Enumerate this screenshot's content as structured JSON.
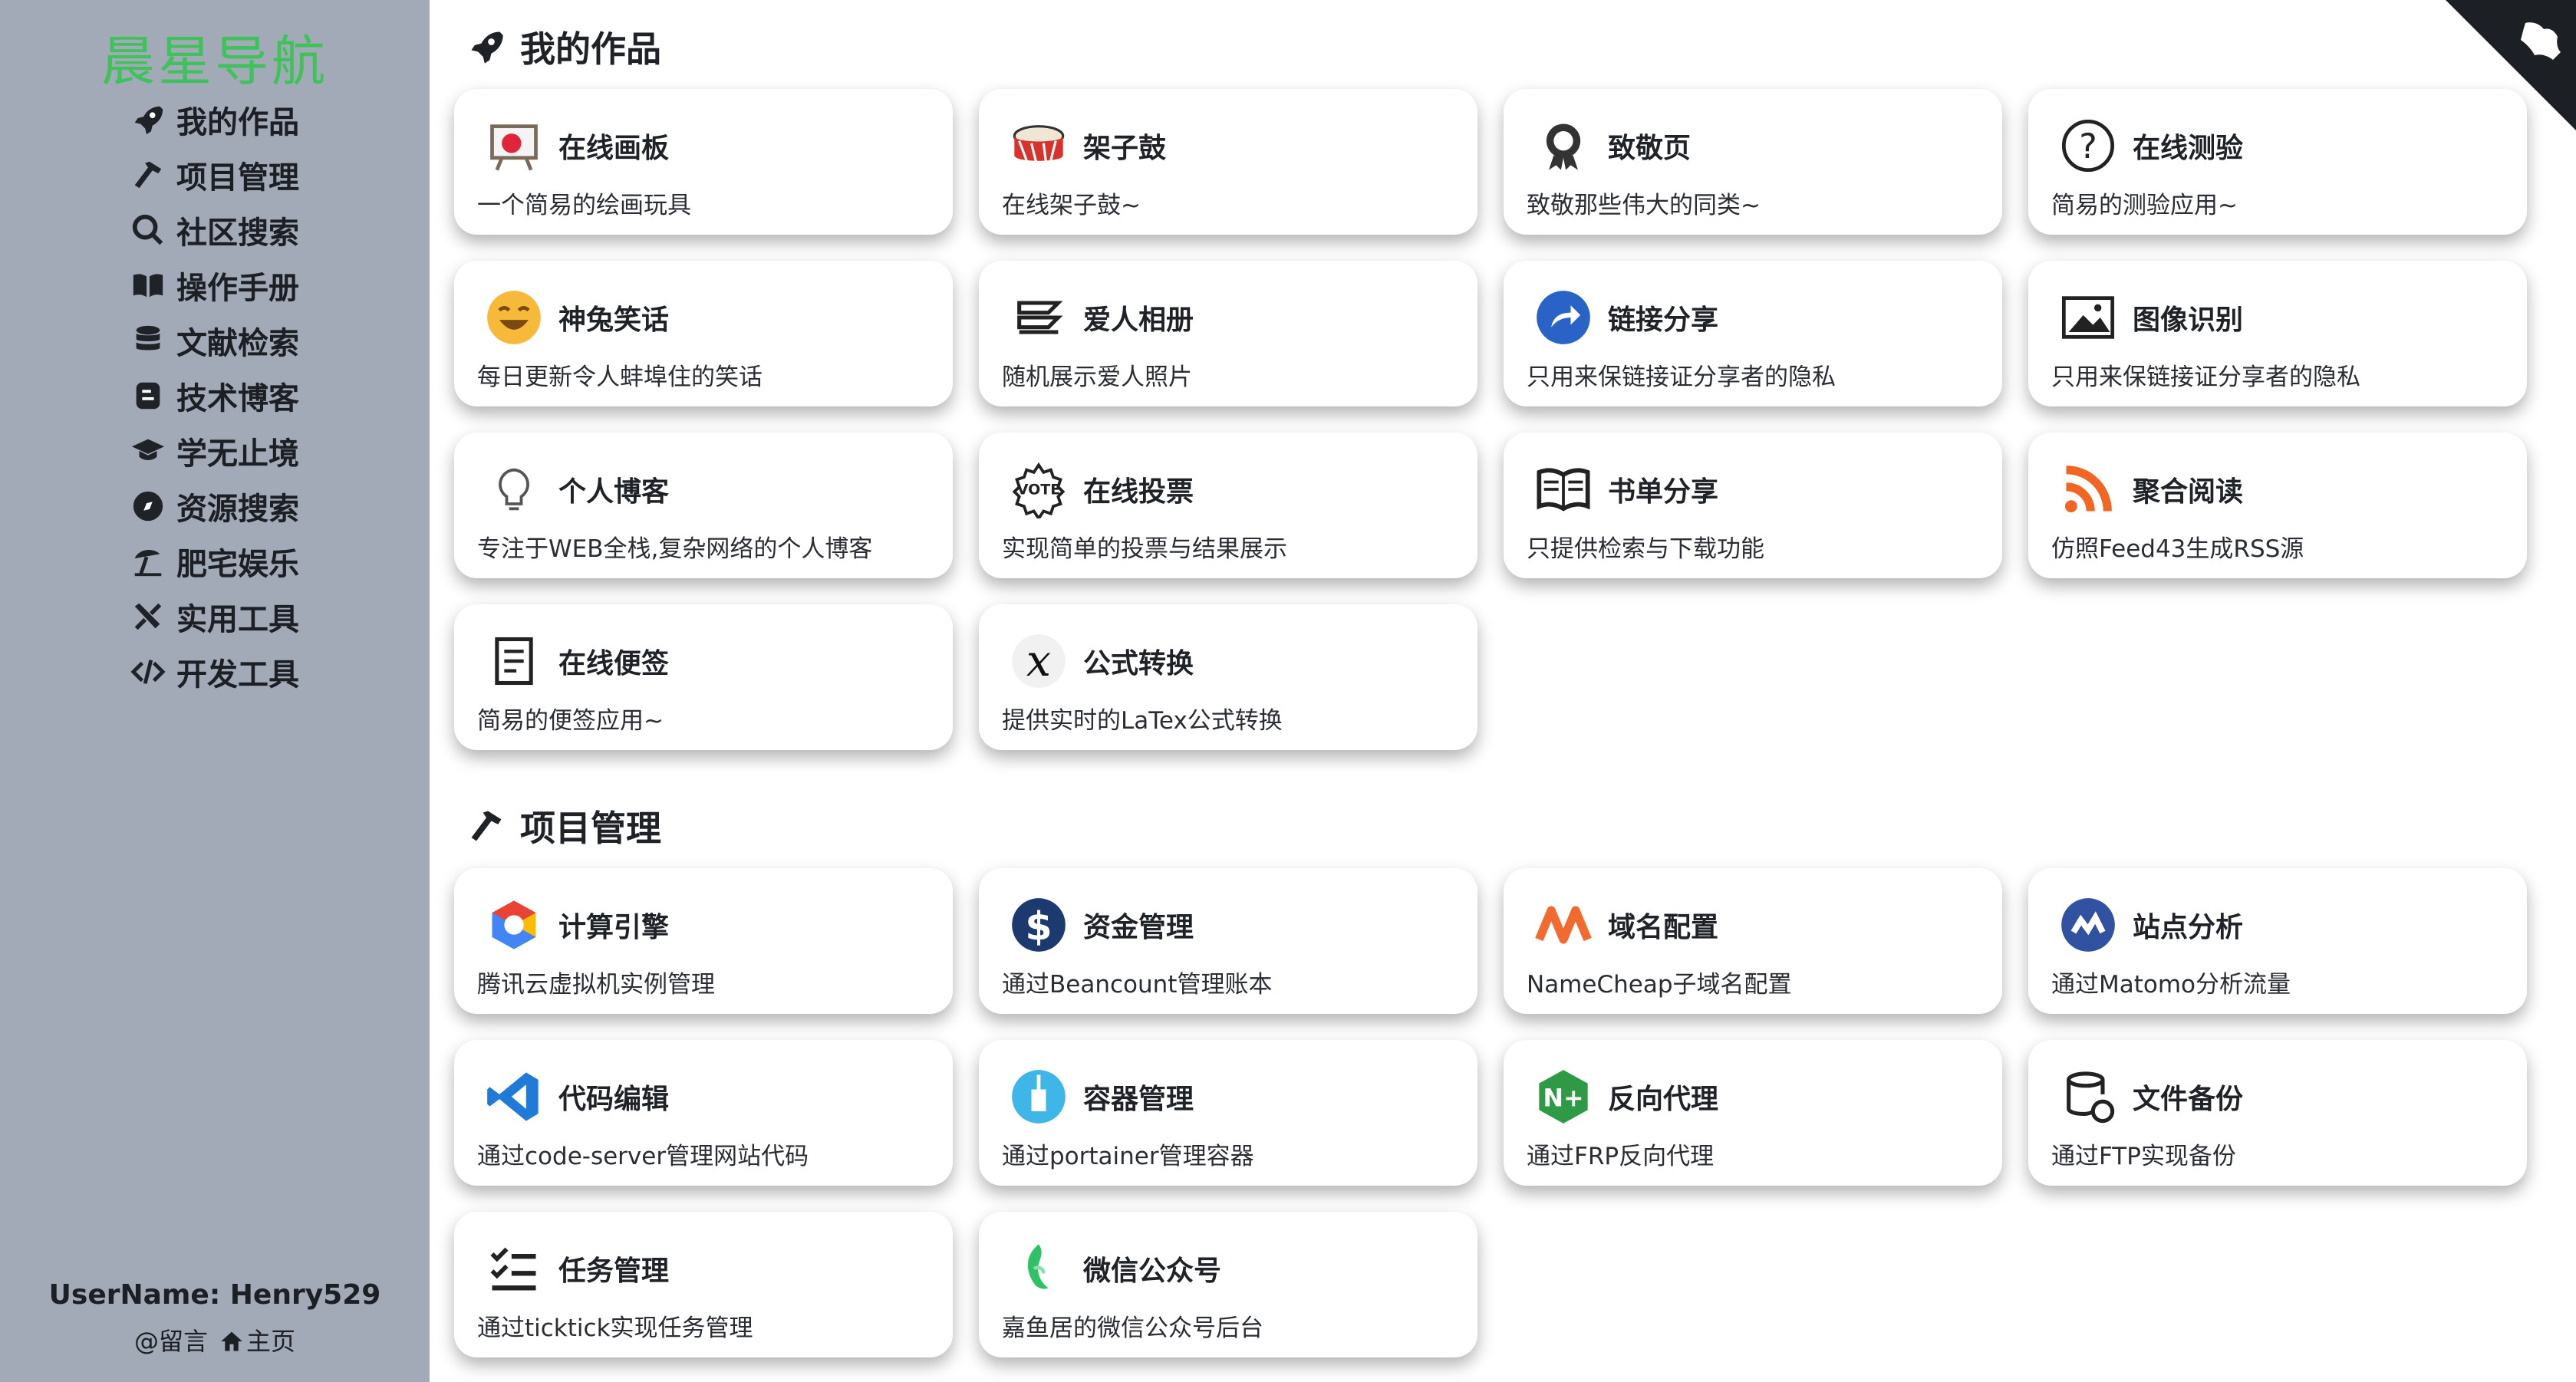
{
  "sidebar": {
    "brand": "晨星导航",
    "nav": [
      {
        "label": "我的作品",
        "icon": "rocket-icon"
      },
      {
        "label": "项目管理",
        "icon": "hammer-icon"
      },
      {
        "label": "社区搜索",
        "icon": "search-icon"
      },
      {
        "label": "操作手册",
        "icon": "book-icon"
      },
      {
        "label": "文献检索",
        "icon": "database-icon"
      },
      {
        "label": "技术博客",
        "icon": "blog-icon"
      },
      {
        "label": "学无止境",
        "icon": "graduation-cap-icon"
      },
      {
        "label": "资源搜索",
        "icon": "compass-icon"
      },
      {
        "label": "肥宅娱乐",
        "icon": "umbrella-beach-icon"
      },
      {
        "label": "实用工具",
        "icon": "tools-icon"
      },
      {
        "label": "开发工具",
        "icon": "code-icon"
      }
    ],
    "username": "UserName: Henry529",
    "links": {
      "message": "@留言",
      "home": "主页"
    }
  },
  "sections": [
    {
      "title": "我的作品",
      "icon": "rocket-icon",
      "cards": [
        {
          "title": "在线画板",
          "desc": "一个简易的绘画玩具",
          "icon": "easel-icon"
        },
        {
          "title": "架子鼓",
          "desc": "在线架子鼓~",
          "icon": "drum-icon"
        },
        {
          "title": "致敬页",
          "desc": "致敬那些伟大的同类~",
          "icon": "medal-icon"
        },
        {
          "title": "在线测验",
          "desc": "简易的测验应用~",
          "icon": "quiz-icon"
        },
        {
          "title": "神兔笑话",
          "desc": "每日更新令人蚌埠住的笑话",
          "icon": "laughing-face-icon"
        },
        {
          "title": "爱人相册",
          "desc": "随机展示爱人照片",
          "icon": "album-icon"
        },
        {
          "title": "链接分享",
          "desc": "只用来保链接证分享者的隐私",
          "icon": "share-icon"
        },
        {
          "title": "图像识别",
          "desc": "只用来保链接证分享者的隐私",
          "icon": "image-icon"
        },
        {
          "title": "个人博客",
          "desc": "专注于WEB全栈,复杂网络的个人博客",
          "icon": "lightbulb-icon"
        },
        {
          "title": "在线投票",
          "desc": "实现简单的投票与结果展示",
          "icon": "vote-icon"
        },
        {
          "title": "书单分享",
          "desc": "只提供检索与下载功能",
          "icon": "open-book-icon"
        },
        {
          "title": "聚合阅读",
          "desc": "仿照Feed43生成RSS源",
          "icon": "rss-icon"
        },
        {
          "title": "在线便签",
          "desc": "简易的便签应用~",
          "icon": "notepad-icon"
        },
        {
          "title": "公式转换",
          "desc": "提供实时的LaTex公式转换",
          "icon": "math-x-icon"
        }
      ]
    },
    {
      "title": "项目管理",
      "icon": "hammer-icon",
      "cards": [
        {
          "title": "计算引擎",
          "desc": "腾讯云虚拟机实例管理",
          "icon": "compute-engine-icon"
        },
        {
          "title": "资金管理",
          "desc": "通过Beancount管理账本",
          "icon": "dollar-icon"
        },
        {
          "title": "域名配置",
          "desc": "NameCheap子域名配置",
          "icon": "namecheap-icon"
        },
        {
          "title": "站点分析",
          "desc": "通过Matomo分析流量",
          "icon": "matomo-icon"
        },
        {
          "title": "代码编辑",
          "desc": "通过code-server管理网站代码",
          "icon": "vscode-icon"
        },
        {
          "title": "容器管理",
          "desc": "通过portainer管理容器",
          "icon": "container-icon"
        },
        {
          "title": "反向代理",
          "desc": "通过FRP反向代理",
          "icon": "nginx-icon"
        },
        {
          "title": "文件备份",
          "desc": "通过FTP实现备份",
          "icon": "backup-icon"
        },
        {
          "title": "任务管理",
          "desc": "通过ticktick实现任务管理",
          "icon": "task-list-icon"
        },
        {
          "title": "微信公众号",
          "desc": "嘉鱼居的微信公众号后台",
          "icon": "wechat-icon"
        }
      ]
    }
  ]
}
